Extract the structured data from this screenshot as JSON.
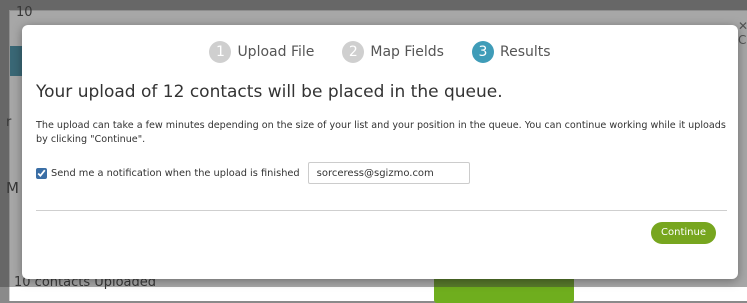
{
  "background": {
    "top_fragment": "10",
    "close_fragment": "✕ A-Co",
    "side_fragment_1": "r",
    "side_fragment_2": "M",
    "bottom_fragment": "10 contacts Uploaded"
  },
  "steps": [
    {
      "number": "1",
      "label": "Upload File",
      "active": false
    },
    {
      "number": "2",
      "label": "Map Fields",
      "active": false
    },
    {
      "number": "3",
      "label": "Results",
      "active": true
    }
  ],
  "heading": "Your upload of 12 contacts will be placed in the queue.",
  "description": "The upload can take a few minutes depending on the size of your list and your position in the queue. You can continue working while it uploads by clicking \"Continue\".",
  "notification": {
    "checked": true,
    "label": "Send me a notification when the upload is finished",
    "email_value": "sorceress@sgizmo.com"
  },
  "continue_label": "Continue",
  "colors": {
    "active_step": "#3f9cb8",
    "inactive_step": "#cfcfcf",
    "continue_button": "#77a61f"
  }
}
